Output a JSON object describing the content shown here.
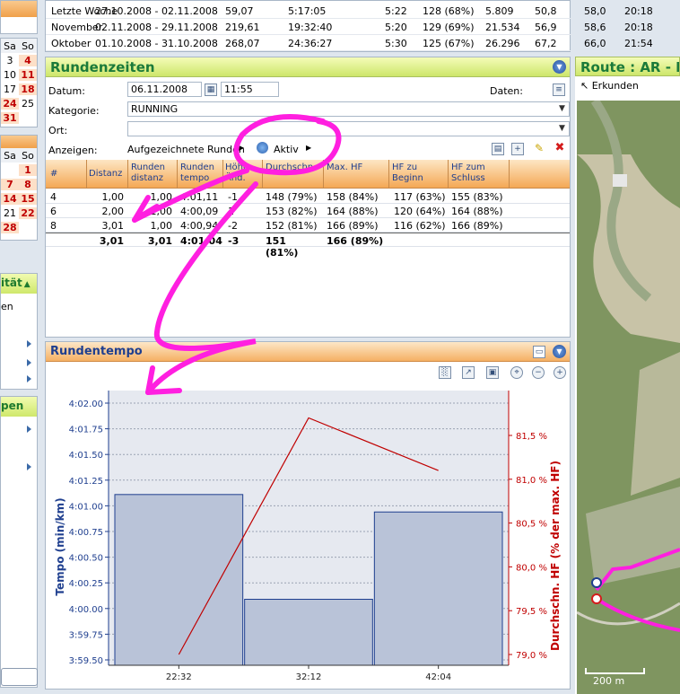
{
  "left_calendar": {
    "header1": [
      "Sa",
      "So"
    ],
    "rows1": [
      [
        "3",
        "4"
      ],
      [
        "10",
        "11"
      ],
      [
        "17",
        "18"
      ],
      [
        "24",
        "25"
      ],
      [
        "31",
        ""
      ]
    ],
    "header2": [
      "Sa",
      "So"
    ],
    "rows2": [
      [
        "",
        "1"
      ],
      [
        "7",
        "8"
      ],
      [
        "14",
        "15"
      ],
      [
        "21",
        "22"
      ],
      [
        "28",
        ""
      ]
    ]
  },
  "left_panels": {
    "activity_title": "ität",
    "activity_item": "en",
    "groups_title": "pen"
  },
  "summary_rows": [
    {
      "label": "Letzte Woche",
      "range": "27.10.2008 - 02.11.2008",
      "dist": "59,07",
      "time": "5:17:05",
      "pace": "5:22",
      "hf": "128 (68%)",
      "cal": "5.809",
      "a": "50,8",
      "b": "58,0",
      "c": "20:18"
    },
    {
      "label": "November",
      "range": "02.11.2008 - 29.11.2008",
      "dist": "219,61",
      "time": "19:32:40",
      "pace": "5:20",
      "hf": "129 (69%)",
      "cal": "21.534",
      "a": "56,9",
      "b": "58,6",
      "c": "20:18"
    },
    {
      "label": "Oktober",
      "range": "01.10.2008 - 31.10.2008",
      "dist": "268,07",
      "time": "24:36:27",
      "pace": "5:30",
      "hf": "125 (67%)",
      "cal": "26.296",
      "a": "67,2",
      "b": "66,0",
      "c": "21:54"
    }
  ],
  "runden": {
    "title": "Rundenzeiten",
    "datum_label": "Datum:",
    "datum_value": "06.11.2008",
    "time_value": "11:55",
    "daten_label": "Daten:",
    "kategorie_label": "Kategorie:",
    "kategorie_value": "RUNNING",
    "ort_label": "Ort:",
    "ort_value": "",
    "anzeigen_label": "Anzeigen:",
    "anzeigen_value": "Aufgezeichnete Runden",
    "aktiv_label": "Aktiv",
    "columns": [
      "#",
      "Distanz",
      "Runden distanz",
      "Runden tempo",
      "Höhe Änd.",
      "Durchschn.",
      "Max. HF",
      "HF zu Beginn",
      "HF zum Schluss"
    ],
    "rows": [
      [
        "4",
        "1,00",
        "1,00",
        "4:01,11",
        "-1",
        "148 (79%)",
        "158 (84%)",
        "117 (63%)",
        "155 (83%)"
      ],
      [
        "6",
        "2,00",
        "1,00",
        "4:00,09",
        "1",
        "153 (82%)",
        "164 (88%)",
        "120 (64%)",
        "164 (88%)"
      ],
      [
        "8",
        "3,01",
        "1,00",
        "4:00,94",
        "-2",
        "152 (81%)",
        "166 (89%)",
        "116 (62%)",
        "166 (89%)"
      ]
    ],
    "sum_row": [
      "",
      "3,01",
      "3,01",
      "4:01,04",
      "-3",
      "151 (81%)",
      "166 (89%)",
      "",
      ""
    ]
  },
  "tempo": {
    "title": "Rundentempo"
  },
  "chart_data": {
    "type": "bar",
    "categories": [
      "22:32",
      "32:12",
      "42:04"
    ],
    "series": [
      {
        "values": [
          241.11,
          240.09,
          240.94
        ],
        "axis": "left"
      },
      {
        "type": "line",
        "values": [
          79.0,
          81.7,
          81.1
        ],
        "axis": "right"
      }
    ],
    "ylabel": "Tempo (min/km)",
    "ylabel_right": "Durchschn. HF (% der max. HF)",
    "y_ticks": [
      "4:02.00",
      "4:01.75",
      "4:01.50",
      "4:01.25",
      "4:01.00",
      "4:00.75",
      "4:00.50",
      "4:00.25",
      "4:00.00",
      "3:59.75",
      "3:59.50"
    ],
    "ylim_seconds": [
      239.5,
      242.0
    ],
    "y2_ticks": [
      "81,5 %",
      "81,0 %",
      "80,5 %",
      "80,0 %",
      "79,5 %",
      "79,0 %"
    ],
    "y2lim": [
      78.9,
      82.0
    ],
    "colors": {
      "bars": "#b9c3d8",
      "bar_edge": "#1f3f8f",
      "line": "#c00000"
    }
  },
  "route": {
    "title": "Route : AR - Hy",
    "erkunden": "Erkunden",
    "scale": "200 m"
  },
  "annotation_color": "#ff1fe0"
}
